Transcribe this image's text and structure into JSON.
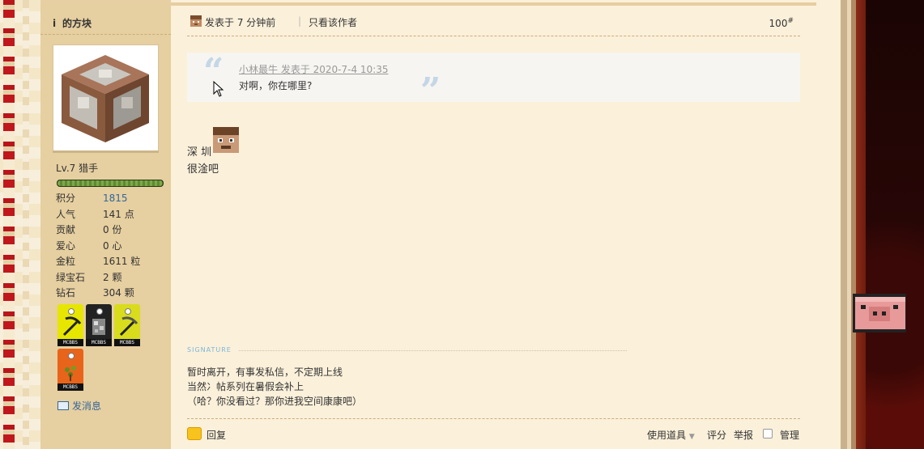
{
  "sidebar": {
    "username": "的方块",
    "level": "Lv.7 猎手",
    "level_progress": 1.0,
    "stats": [
      {
        "key": "积分",
        "value": "1815"
      },
      {
        "key": "人气",
        "value": "141 点"
      },
      {
        "key": "贡献",
        "value": "0 份"
      },
      {
        "key": "爱心",
        "value": "0 心"
      },
      {
        "key": "金粒",
        "value": "1611 粒"
      },
      {
        "key": "绿宝石",
        "value": "2 颗"
      },
      {
        "key": "钻石",
        "value": "304 颗"
      }
    ],
    "badges": [
      {
        "label": "MCBBS",
        "icon": "pickaxe-icon",
        "color": "#e6e600"
      },
      {
        "label": "MCBBS",
        "icon": "ore-icon",
        "color": "#222222"
      },
      {
        "label": "MCBBS",
        "icon": "pickaxe-icon",
        "color": "#d8dc1c"
      },
      {
        "label": "MCBBS",
        "icon": "sapling-icon",
        "color": "#e8641a"
      }
    ],
    "send_message": "发消息"
  },
  "post": {
    "posted_time": "发表于 7 分钟前",
    "separator": "|",
    "only_author": "只看该作者",
    "floor_number": "100",
    "floor_suffix": "#",
    "quote": {
      "author_line": "小林最牛 发表于 2020-7-4 10:35",
      "text": "对啊，你在哪里?"
    },
    "body_line1": "深 圳",
    "body_line2": "很淦吧",
    "signature_label": "SIGNATURE",
    "signature_lines": [
      "暂时离开，有事发私信，不定期上线",
      "当然冫帖系列在暑假会补上",
      "（哈？你没看过？那你进我空间康康吧）"
    ]
  },
  "footer": {
    "reply": "回复",
    "use_tools": "使用道具",
    "caret": "▼",
    "rate": "评分",
    "report": "举报",
    "manage": "管理"
  },
  "colors": {
    "page_bg": "#fbf0da",
    "sidebar_bg": "#e6cfa0",
    "link": "#336699",
    "quote_mark": "#c5d6e6"
  }
}
